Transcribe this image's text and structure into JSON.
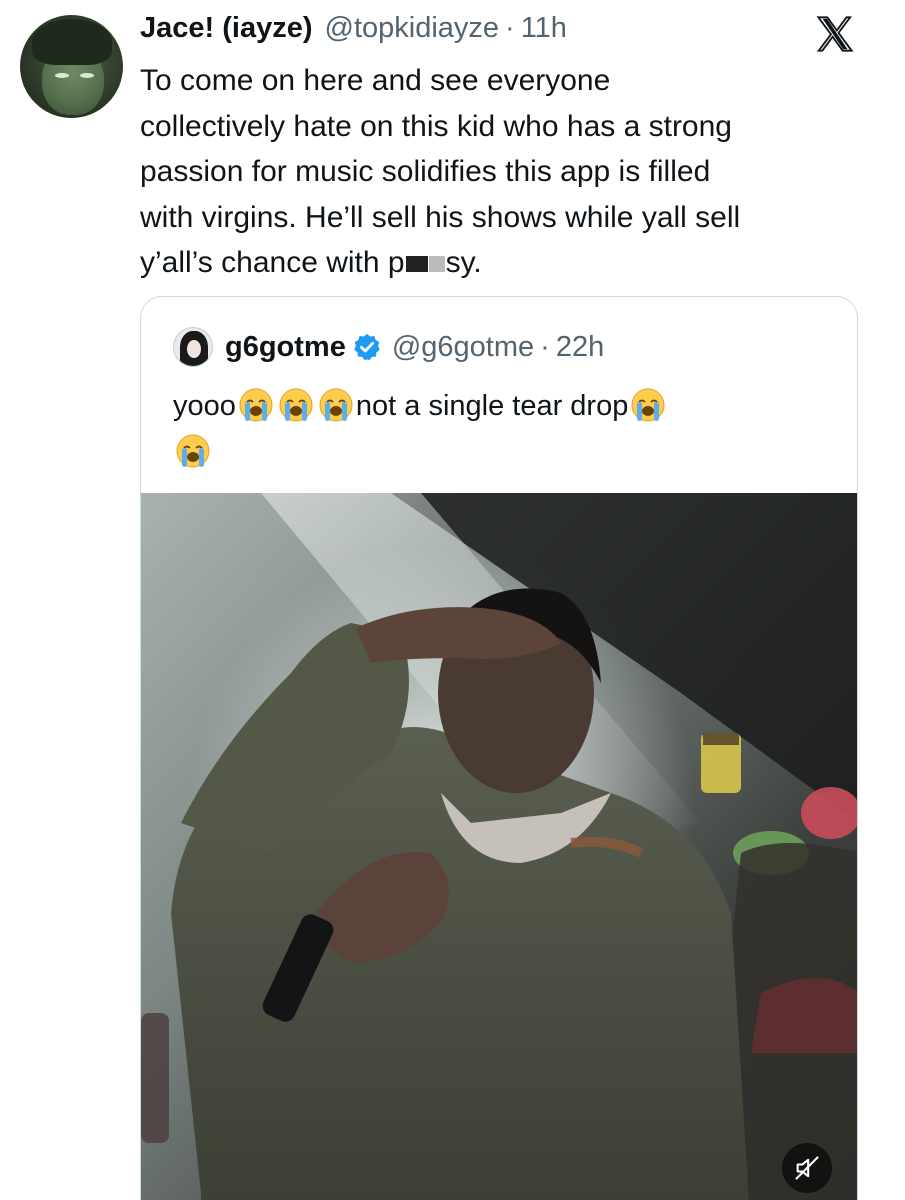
{
  "tweet": {
    "author_name": "Jace! (iayze)",
    "author_handle": "@topkidiayze",
    "separator": "·",
    "time": "11h",
    "text_lines": [
      "To come on here and see everyone",
      "collectively hate on this kid who has a strong",
      "passion for music solidifies this app is filled",
      "with virgins. He’ll sell his shows while yall sell"
    ],
    "text_last_before": "y’all’s chance with p",
    "text_last_after": "sy.",
    "platform_icon": "x-logo-icon"
  },
  "quoted": {
    "author_name": "g6gotme",
    "verified_icon": "verified-badge-icon",
    "author_handle": "@g6gotme",
    "separator": "·",
    "time": "22h",
    "text_start": "yooo",
    "text_middle": "not a single tear drop",
    "emoji_icon": "loudly-crying-face-icon",
    "media_type": "video",
    "media_icon": "muted-speaker-icon"
  },
  "colors": {
    "text": "#0f1419",
    "secondary": "#536471",
    "verified": "#1d9bf0",
    "border": "#cfd9de"
  }
}
